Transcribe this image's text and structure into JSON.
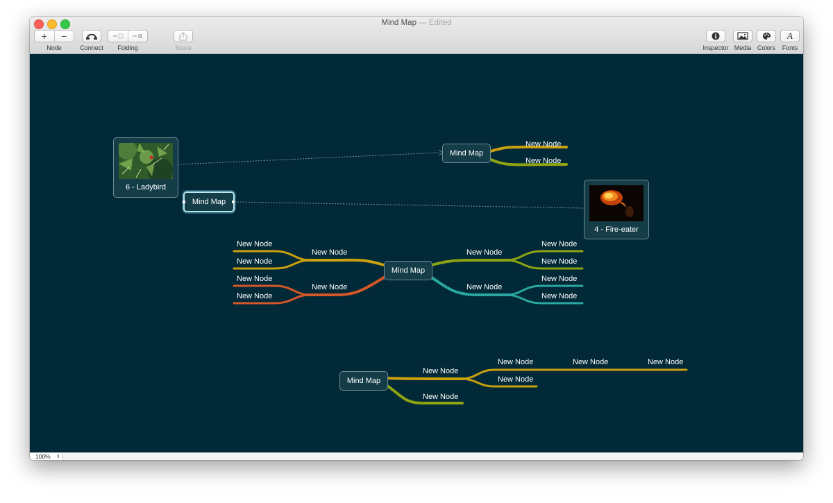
{
  "window": {
    "title": "Mind Map",
    "separator": "—",
    "edited": "Edited"
  },
  "toolbar": {
    "node_label": "Node",
    "add_glyph": "+",
    "remove_glyph": "−",
    "connect_label": "Connect",
    "folding_label": "Folding",
    "share_label": "Share",
    "inspector_label": "Inspector",
    "media_label": "Media",
    "colors_label": "Colors",
    "fonts_label": "Fonts",
    "fonts_glyph": "A"
  },
  "canvas": {
    "background": "#022937",
    "ladybird_card": {
      "caption": "6 - Ladybird"
    },
    "fireeater_card": {
      "caption": "4 - Fire-eater"
    },
    "selected_node": {
      "label": "Mind Map"
    },
    "top_map": {
      "center": "Mind Map",
      "children": [
        "New Node",
        "New Node"
      ]
    },
    "middle_map": {
      "center": "Mind Map",
      "left_branches": [
        {
          "label": "New Node",
          "children": [
            "New Node",
            "New Node"
          ]
        },
        {
          "label": "New Node",
          "children": [
            "New Node",
            "New Node"
          ]
        }
      ],
      "right_branches": [
        {
          "label": "New Node",
          "children": [
            "New Node",
            "New Node"
          ]
        },
        {
          "label": "New Node",
          "children": [
            "New Node",
            "New Node"
          ]
        }
      ]
    },
    "bottom_map": {
      "center": "Mind Map",
      "branch_1": {
        "label": "New Node",
        "children": [
          "New Node",
          "New Node"
        ],
        "chain": [
          "New Node",
          "New Node"
        ]
      },
      "branch_2": {
        "label": "New Node"
      }
    },
    "branch_colors": {
      "gold": "#c9a00e",
      "olive": "#8ea312",
      "orange": "#d4572a",
      "teal": "#2aa7a0",
      "connector": "#7a969d"
    }
  },
  "statusbar": {
    "zoom": "100%"
  }
}
